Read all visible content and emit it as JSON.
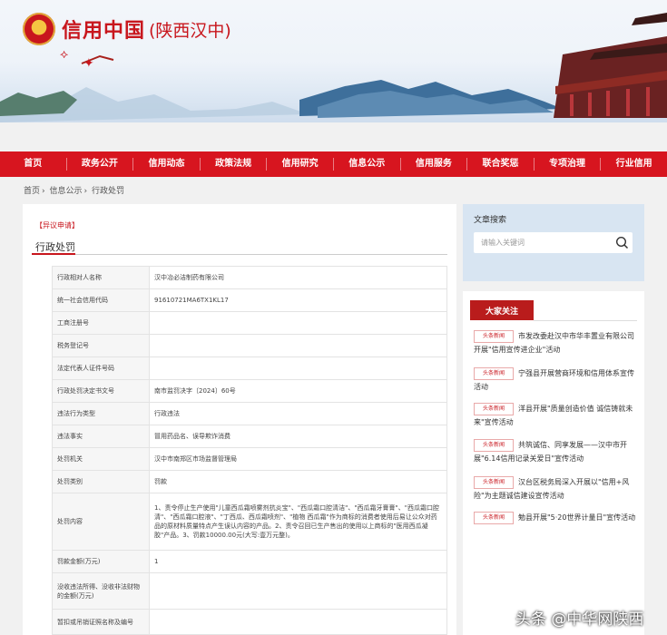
{
  "site": {
    "brand": "信用中国",
    "region": "(陕西汉中)"
  },
  "nav": [
    "首页",
    "政务公开",
    "信用动态",
    "政策法规",
    "信用研究",
    "信息公示",
    "信用服务",
    "联合奖惩",
    "专项治理",
    "行业信用"
  ],
  "breadcrumb": [
    "首页",
    "信息公示",
    "行政处罚"
  ],
  "page": {
    "tag": "【异议申请】",
    "title": "行政处罚",
    "rows": [
      {
        "label": "行政相对人名称",
        "value": "汉中冶必洁制药有限公司"
      },
      {
        "label": "统一社会信用代码",
        "value": "91610721MA6TX1KL17"
      },
      {
        "label": "工商注册号",
        "value": ""
      },
      {
        "label": "税务登记号",
        "value": ""
      },
      {
        "label": "法定代表人证件号码",
        "value": ""
      },
      {
        "label": "行政处罚决定书文号",
        "value": "南市监罚决字〔2024〕60号"
      },
      {
        "label": "违法行为类型",
        "value": "行政违法"
      },
      {
        "label": "违法事实",
        "value": "冒用药品名、误导欺诈消费"
      },
      {
        "label": "处罚机关",
        "value": "汉中市南郑区市场监督管理局"
      },
      {
        "label": "处罚类别",
        "value": "罚款"
      },
      {
        "label": "处罚内容",
        "value": "1、责令停止生产使用\"儿童西瓜霜喷雾剂抗炎宝\"、\"西瓜霜口腔清洁\"、\"西瓜霜牙膏膏\"、\"西瓜霜口腔清\"、\"西瓜霜口腔液\"、\"丁西瓜、西瓜霜喷剂\"、\"植物 西瓜霜\"作为商标的消费者使用后易让公众对药品的原材料质量特点产生误认内容的产品。2、责令召回已生产售出的使用以上商标的\"医用西瓜凝胶\"产品。3、罚款10000.00元(大写:壹万元整)。"
      },
      {
        "label": "罚款金额(万元)",
        "value": "1"
      },
      {
        "label": "没收违法所得、没收非法财物的金额(万元)",
        "value": ""
      },
      {
        "label": "暂扣或吊销证照名称及编号",
        "value": ""
      }
    ]
  },
  "search": {
    "title": "文章搜索",
    "placeholder": "请输入关键词"
  },
  "hot": {
    "title": "大家关注",
    "badge": "头条新闻",
    "items": [
      "市发改委赴汉中市华丰置业有限公司 开展\"信用宣传进企业\"活动",
      "宁强县开展营商环境和信用体系宣传活动",
      "洋县开展\"质量创造价值 诚信铸就未来\"宣传活动",
      "共筑诚信、同享发展——汉中市开展\"6.14信用记录关爱日\"宣传活动",
      "汉台区税务局深入开展以\"信用+风险\"为主题诚信建设宣传活动",
      "勉县开展\"5·20世界计量日\"宣传活动"
    ]
  },
  "watermark": "头条 @中华网陕西"
}
